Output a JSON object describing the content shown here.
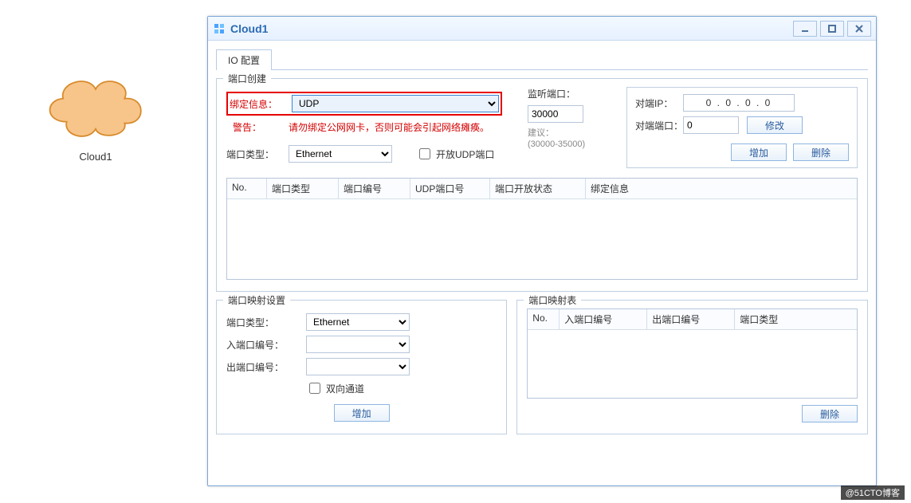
{
  "cloud_icon": {
    "label": "Cloud1"
  },
  "window": {
    "title": "Cloud1",
    "tabs": {
      "io": "IO 配置"
    },
    "port_create": {
      "legend": "端口创建",
      "bind_label": "绑定信息：",
      "bind_value": "UDP",
      "warn_label": "警告：",
      "warn_text": "请勿绑定公网网卡，否则可能会引起网络瘫痪。",
      "port_type_label": "端口类型：",
      "port_type_value": "Ethernet",
      "open_udp_label": "开放UDP端口",
      "listen_port_label": "监听端口：",
      "listen_port_value": "30000",
      "suggest_label": "建议：",
      "suggest_range": "(30000-35000)",
      "peer_ip_label": "对端IP：",
      "peer_ip_value": "0    .    0    .    0    .    0",
      "peer_port_label": "对端端口：",
      "peer_port_value": "0",
      "btn_modify": "修改",
      "btn_add": "增加",
      "btn_remove": "删除",
      "table_headers": {
        "no": "No.",
        "type": "端口类型",
        "portno": "端口编号",
        "udpno": "UDP端口号",
        "openstat": "端口开放状态",
        "bindinfo": "绑定信息"
      }
    },
    "map_settings": {
      "legend": "端口映射设置",
      "port_type_label": "端口类型：",
      "port_type_value": "Ethernet",
      "in_no_label": "入端口编号：",
      "out_no_label": "出端口编号：",
      "bidir_label": "双向通道",
      "btn_add": "增加"
    },
    "map_table": {
      "legend": "端口映射表",
      "headers": {
        "no": "No.",
        "in": "入端口编号",
        "out": "出端口编号",
        "type": "端口类型"
      },
      "btn_remove": "删除"
    }
  },
  "watermark": "@51CTO博客"
}
